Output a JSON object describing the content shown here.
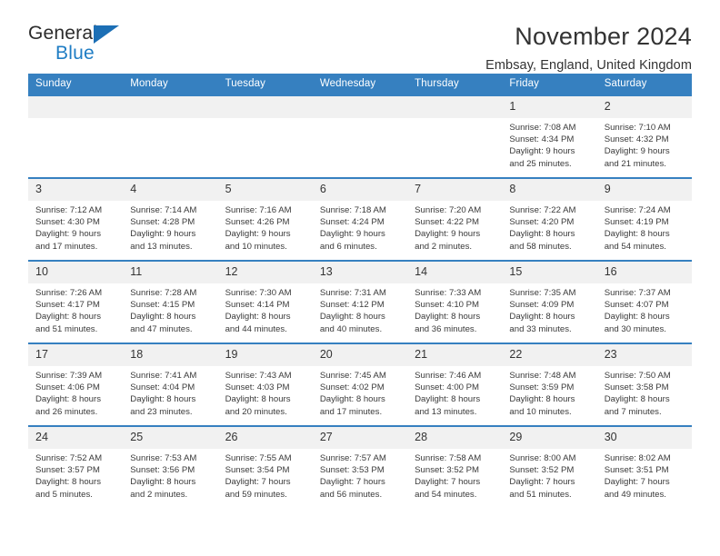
{
  "brand": {
    "name_part1": "General",
    "name_part2": "Blue",
    "flag_icon": "triangle-flag-icon",
    "accent_color": "#1c6fb5"
  },
  "header": {
    "title": "November 2024",
    "subtitle": "Embsay, England, United Kingdom"
  },
  "theme": {
    "header_bg": "#3680c0",
    "daynum_bg": "#f1f1f1",
    "row_border": "#3680c0",
    "text": "#333333"
  },
  "calendar": {
    "weekday_headers": [
      "Sunday",
      "Monday",
      "Tuesday",
      "Wednesday",
      "Thursday",
      "Friday",
      "Saturday"
    ],
    "labels": {
      "sunrise": "Sunrise:",
      "sunset": "Sunset:",
      "daylight": "Daylight:"
    },
    "weeks": [
      [
        {
          "day": "",
          "lines": []
        },
        {
          "day": "",
          "lines": []
        },
        {
          "day": "",
          "lines": []
        },
        {
          "day": "",
          "lines": []
        },
        {
          "day": "",
          "lines": []
        },
        {
          "day": "1",
          "sunrise": "7:08 AM",
          "sunset": "4:34 PM",
          "daylight_hours": 9,
          "daylight_minutes": 25,
          "lines": [
            "Sunrise: 7:08 AM",
            "Sunset: 4:34 PM",
            "Daylight: 9 hours",
            "and 25 minutes."
          ]
        },
        {
          "day": "2",
          "sunrise": "7:10 AM",
          "sunset": "4:32 PM",
          "daylight_hours": 9,
          "daylight_minutes": 21,
          "lines": [
            "Sunrise: 7:10 AM",
            "Sunset: 4:32 PM",
            "Daylight: 9 hours",
            "and 21 minutes."
          ]
        }
      ],
      [
        {
          "day": "3",
          "sunrise": "7:12 AM",
          "sunset": "4:30 PM",
          "daylight_hours": 9,
          "daylight_minutes": 17,
          "lines": [
            "Sunrise: 7:12 AM",
            "Sunset: 4:30 PM",
            "Daylight: 9 hours",
            "and 17 minutes."
          ]
        },
        {
          "day": "4",
          "sunrise": "7:14 AM",
          "sunset": "4:28 PM",
          "daylight_hours": 9,
          "daylight_minutes": 13,
          "lines": [
            "Sunrise: 7:14 AM",
            "Sunset: 4:28 PM",
            "Daylight: 9 hours",
            "and 13 minutes."
          ]
        },
        {
          "day": "5",
          "sunrise": "7:16 AM",
          "sunset": "4:26 PM",
          "daylight_hours": 9,
          "daylight_minutes": 10,
          "lines": [
            "Sunrise: 7:16 AM",
            "Sunset: 4:26 PM",
            "Daylight: 9 hours",
            "and 10 minutes."
          ]
        },
        {
          "day": "6",
          "sunrise": "7:18 AM",
          "sunset": "4:24 PM",
          "daylight_hours": 9,
          "daylight_minutes": 6,
          "lines": [
            "Sunrise: 7:18 AM",
            "Sunset: 4:24 PM",
            "Daylight: 9 hours",
            "and 6 minutes."
          ]
        },
        {
          "day": "7",
          "sunrise": "7:20 AM",
          "sunset": "4:22 PM",
          "daylight_hours": 9,
          "daylight_minutes": 2,
          "lines": [
            "Sunrise: 7:20 AM",
            "Sunset: 4:22 PM",
            "Daylight: 9 hours",
            "and 2 minutes."
          ]
        },
        {
          "day": "8",
          "sunrise": "7:22 AM",
          "sunset": "4:20 PM",
          "daylight_hours": 8,
          "daylight_minutes": 58,
          "lines": [
            "Sunrise: 7:22 AM",
            "Sunset: 4:20 PM",
            "Daylight: 8 hours",
            "and 58 minutes."
          ]
        },
        {
          "day": "9",
          "sunrise": "7:24 AM",
          "sunset": "4:19 PM",
          "daylight_hours": 8,
          "daylight_minutes": 54,
          "lines": [
            "Sunrise: 7:24 AM",
            "Sunset: 4:19 PM",
            "Daylight: 8 hours",
            "and 54 minutes."
          ]
        }
      ],
      [
        {
          "day": "10",
          "sunrise": "7:26 AM",
          "sunset": "4:17 PM",
          "daylight_hours": 8,
          "daylight_minutes": 51,
          "lines": [
            "Sunrise: 7:26 AM",
            "Sunset: 4:17 PM",
            "Daylight: 8 hours",
            "and 51 minutes."
          ]
        },
        {
          "day": "11",
          "sunrise": "7:28 AM",
          "sunset": "4:15 PM",
          "daylight_hours": 8,
          "daylight_minutes": 47,
          "lines": [
            "Sunrise: 7:28 AM",
            "Sunset: 4:15 PM",
            "Daylight: 8 hours",
            "and 47 minutes."
          ]
        },
        {
          "day": "12",
          "sunrise": "7:30 AM",
          "sunset": "4:14 PM",
          "daylight_hours": 8,
          "daylight_minutes": 44,
          "lines": [
            "Sunrise: 7:30 AM",
            "Sunset: 4:14 PM",
            "Daylight: 8 hours",
            "and 44 minutes."
          ]
        },
        {
          "day": "13",
          "sunrise": "7:31 AM",
          "sunset": "4:12 PM",
          "daylight_hours": 8,
          "daylight_minutes": 40,
          "lines": [
            "Sunrise: 7:31 AM",
            "Sunset: 4:12 PM",
            "Daylight: 8 hours",
            "and 40 minutes."
          ]
        },
        {
          "day": "14",
          "sunrise": "7:33 AM",
          "sunset": "4:10 PM",
          "daylight_hours": 8,
          "daylight_minutes": 36,
          "lines": [
            "Sunrise: 7:33 AM",
            "Sunset: 4:10 PM",
            "Daylight: 8 hours",
            "and 36 minutes."
          ]
        },
        {
          "day": "15",
          "sunrise": "7:35 AM",
          "sunset": "4:09 PM",
          "daylight_hours": 8,
          "daylight_minutes": 33,
          "lines": [
            "Sunrise: 7:35 AM",
            "Sunset: 4:09 PM",
            "Daylight: 8 hours",
            "and 33 minutes."
          ]
        },
        {
          "day": "16",
          "sunrise": "7:37 AM",
          "sunset": "4:07 PM",
          "daylight_hours": 8,
          "daylight_minutes": 30,
          "lines": [
            "Sunrise: 7:37 AM",
            "Sunset: 4:07 PM",
            "Daylight: 8 hours",
            "and 30 minutes."
          ]
        }
      ],
      [
        {
          "day": "17",
          "sunrise": "7:39 AM",
          "sunset": "4:06 PM",
          "daylight_hours": 8,
          "daylight_minutes": 26,
          "lines": [
            "Sunrise: 7:39 AM",
            "Sunset: 4:06 PM",
            "Daylight: 8 hours",
            "and 26 minutes."
          ]
        },
        {
          "day": "18",
          "sunrise": "7:41 AM",
          "sunset": "4:04 PM",
          "daylight_hours": 8,
          "daylight_minutes": 23,
          "lines": [
            "Sunrise: 7:41 AM",
            "Sunset: 4:04 PM",
            "Daylight: 8 hours",
            "and 23 minutes."
          ]
        },
        {
          "day": "19",
          "sunrise": "7:43 AM",
          "sunset": "4:03 PM",
          "daylight_hours": 8,
          "daylight_minutes": 20,
          "lines": [
            "Sunrise: 7:43 AM",
            "Sunset: 4:03 PM",
            "Daylight: 8 hours",
            "and 20 minutes."
          ]
        },
        {
          "day": "20",
          "sunrise": "7:45 AM",
          "sunset": "4:02 PM",
          "daylight_hours": 8,
          "daylight_minutes": 17,
          "lines": [
            "Sunrise: 7:45 AM",
            "Sunset: 4:02 PM",
            "Daylight: 8 hours",
            "and 17 minutes."
          ]
        },
        {
          "day": "21",
          "sunrise": "7:46 AM",
          "sunset": "4:00 PM",
          "daylight_hours": 8,
          "daylight_minutes": 13,
          "lines": [
            "Sunrise: 7:46 AM",
            "Sunset: 4:00 PM",
            "Daylight: 8 hours",
            "and 13 minutes."
          ]
        },
        {
          "day": "22",
          "sunrise": "7:48 AM",
          "sunset": "3:59 PM",
          "daylight_hours": 8,
          "daylight_minutes": 10,
          "lines": [
            "Sunrise: 7:48 AM",
            "Sunset: 3:59 PM",
            "Daylight: 8 hours",
            "and 10 minutes."
          ]
        },
        {
          "day": "23",
          "sunrise": "7:50 AM",
          "sunset": "3:58 PM",
          "daylight_hours": 8,
          "daylight_minutes": 7,
          "lines": [
            "Sunrise: 7:50 AM",
            "Sunset: 3:58 PM",
            "Daylight: 8 hours",
            "and 7 minutes."
          ]
        }
      ],
      [
        {
          "day": "24",
          "sunrise": "7:52 AM",
          "sunset": "3:57 PM",
          "daylight_hours": 8,
          "daylight_minutes": 5,
          "lines": [
            "Sunrise: 7:52 AM",
            "Sunset: 3:57 PM",
            "Daylight: 8 hours",
            "and 5 minutes."
          ]
        },
        {
          "day": "25",
          "sunrise": "7:53 AM",
          "sunset": "3:56 PM",
          "daylight_hours": 8,
          "daylight_minutes": 2,
          "lines": [
            "Sunrise: 7:53 AM",
            "Sunset: 3:56 PM",
            "Daylight: 8 hours",
            "and 2 minutes."
          ]
        },
        {
          "day": "26",
          "sunrise": "7:55 AM",
          "sunset": "3:54 PM",
          "daylight_hours": 7,
          "daylight_minutes": 59,
          "lines": [
            "Sunrise: 7:55 AM",
            "Sunset: 3:54 PM",
            "Daylight: 7 hours",
            "and 59 minutes."
          ]
        },
        {
          "day": "27",
          "sunrise": "7:57 AM",
          "sunset": "3:53 PM",
          "daylight_hours": 7,
          "daylight_minutes": 56,
          "lines": [
            "Sunrise: 7:57 AM",
            "Sunset: 3:53 PM",
            "Daylight: 7 hours",
            "and 56 minutes."
          ]
        },
        {
          "day": "28",
          "sunrise": "7:58 AM",
          "sunset": "3:52 PM",
          "daylight_hours": 7,
          "daylight_minutes": 54,
          "lines": [
            "Sunrise: 7:58 AM",
            "Sunset: 3:52 PM",
            "Daylight: 7 hours",
            "and 54 minutes."
          ]
        },
        {
          "day": "29",
          "sunrise": "8:00 AM",
          "sunset": "3:52 PM",
          "daylight_hours": 7,
          "daylight_minutes": 51,
          "lines": [
            "Sunrise: 8:00 AM",
            "Sunset: 3:52 PM",
            "Daylight: 7 hours",
            "and 51 minutes."
          ]
        },
        {
          "day": "30",
          "sunrise": "8:02 AM",
          "sunset": "3:51 PM",
          "daylight_hours": 7,
          "daylight_minutes": 49,
          "lines": [
            "Sunrise: 8:02 AM",
            "Sunset: 3:51 PM",
            "Daylight: 7 hours",
            "and 49 minutes."
          ]
        }
      ]
    ]
  }
}
